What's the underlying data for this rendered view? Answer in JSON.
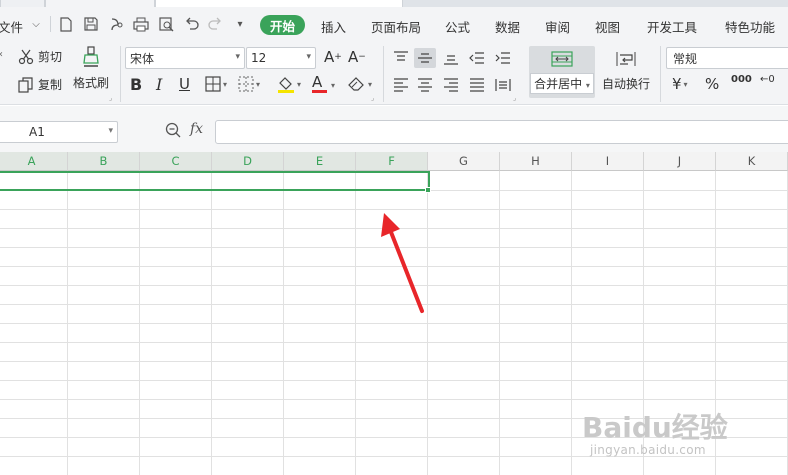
{
  "menubar": {
    "file_label": "文件",
    "tabs": [
      "开始",
      "插入",
      "页面布局",
      "公式",
      "数据",
      "审阅",
      "视图",
      "开发工具",
      "特色功能"
    ]
  },
  "ribbon": {
    "cut_label": "剪切",
    "copy_label": "复制",
    "format_painter_label": "格式刷",
    "font_name": "宋体",
    "font_size": "12",
    "merge_center_label": "合并居中",
    "wrap_text_label": "自动换行",
    "number_format": "常规",
    "bold_label": "B",
    "italic_label": "I",
    "underline_label": "U",
    "font_grow_label": "A",
    "font_shrink_label": "A",
    "font_color_label": "A",
    "currency_label": "¥",
    "percent_label": "%",
    "thousands_label": "000",
    "decimal_label": "←0"
  },
  "formula_bar": {
    "name_box": "A1",
    "fx_label": "fx",
    "formula": ""
  },
  "grid": {
    "columns": [
      "A",
      "B",
      "C",
      "D",
      "E",
      "F",
      "G",
      "H",
      "I",
      "J",
      "K"
    ],
    "selected_columns": [
      "A",
      "B",
      "C",
      "D",
      "E",
      "F"
    ]
  },
  "watermark": {
    "title": "Baidu经验",
    "url": "jingyan.baidu.com"
  },
  "colors": {
    "accent": "#3aa35a",
    "arrow": "#e8262a"
  }
}
